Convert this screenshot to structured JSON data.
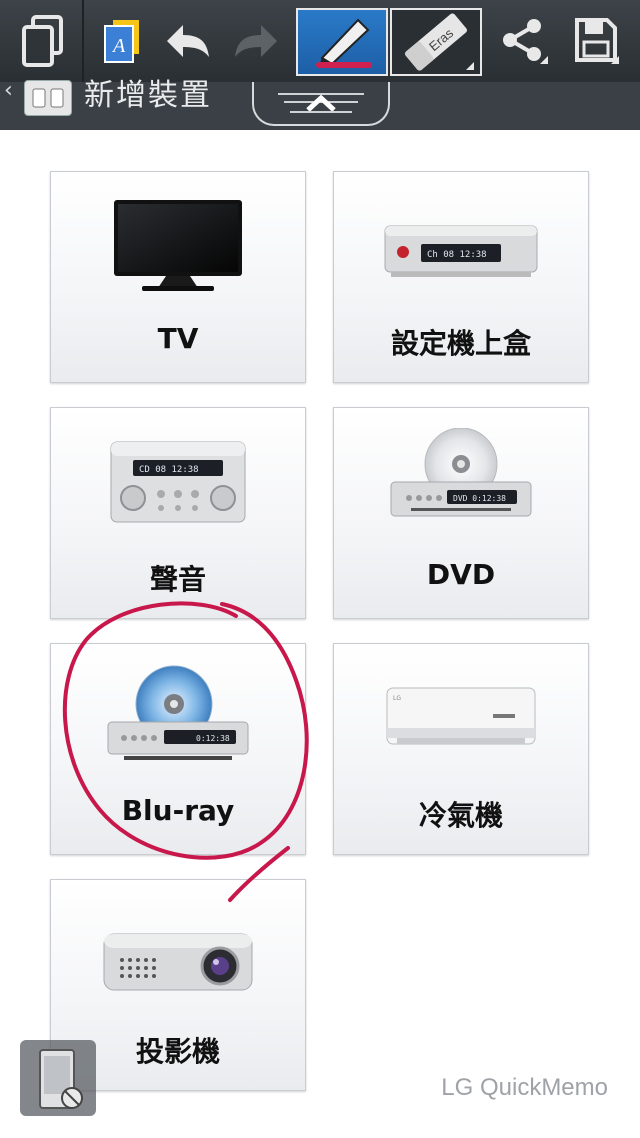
{
  "header": {
    "title": "新增裝置"
  },
  "toolbar": {
    "pen_color": "#d0204f",
    "icons": [
      "copy-icon",
      "text-insert-icon",
      "undo-icon",
      "redo-icon",
      "pen-icon",
      "eraser-icon",
      "share-icon",
      "save-icon"
    ],
    "eraser_label": "Eras"
  },
  "devices": [
    {
      "label": "TV",
      "icon": "tv-icon"
    },
    {
      "label": "設定機上盒",
      "icon": "set-top-box-icon",
      "display": "Ch 08   12:38"
    },
    {
      "label": "聲音",
      "icon": "audio-system-icon",
      "display": "CD 08   12:38"
    },
    {
      "label": "DVD",
      "icon": "dvd-player-icon",
      "display": "DVD  0:12:38"
    },
    {
      "label": "Blu-ray",
      "icon": "bluray-player-icon",
      "display": "0:12:38"
    },
    {
      "label": "冷氣機",
      "icon": "air-conditioner-icon"
    },
    {
      "label": "投影機",
      "icon": "projector-icon"
    }
  ],
  "footer": {
    "watermark": "LG QuickMemo"
  },
  "annotation": {
    "color": "#c8174a",
    "shape": "hand-drawn circle around Blu-ray"
  }
}
